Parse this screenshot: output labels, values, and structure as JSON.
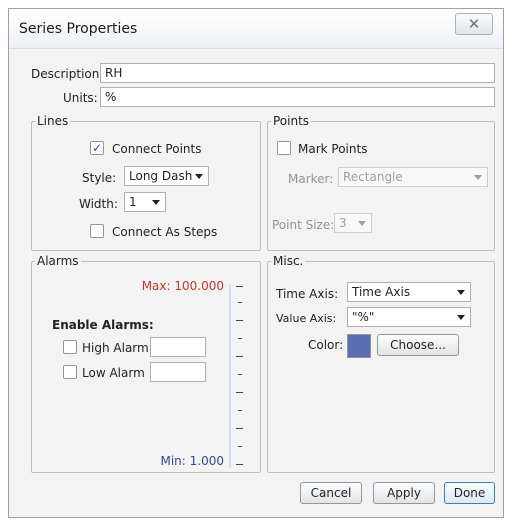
{
  "window": {
    "title": "Series Properties",
    "close_glyph": "✕"
  },
  "fields": {
    "description_label": "Description:",
    "description_value": "RH",
    "units_label": "Units:",
    "units_value": "%"
  },
  "lines": {
    "legend": "Lines",
    "connect_points_label": "Connect Points",
    "connect_points_checked": true,
    "style_label": "Style:",
    "style_value": "Long Dash",
    "width_label": "Width:",
    "width_value": "1",
    "connect_steps_label": "Connect As Steps",
    "connect_steps_checked": false
  },
  "points": {
    "legend": "Points",
    "mark_points_label": "Mark Points",
    "mark_points_checked": false,
    "marker_label": "Marker:",
    "marker_value": "Rectangle",
    "point_size_label": "Point Size:",
    "point_size_value": "3"
  },
  "alarms": {
    "legend": "Alarms",
    "max_label": "Max: 100.000",
    "min_label": "Min: 1.000",
    "enable_label": "Enable Alarms:",
    "high_label": "High Alarm",
    "high_checked": false,
    "high_value": "",
    "low_label": "Low Alarm",
    "low_checked": false,
    "low_value": ""
  },
  "misc": {
    "legend": "Misc.",
    "time_axis_label": "Time Axis:",
    "time_axis_value": "Time Axis",
    "value_axis_label": "Value Axis:",
    "value_axis_value": "\"%\"",
    "color_label": "Color:",
    "color_value": "#5b6eb3",
    "choose_label": "Choose..."
  },
  "buttons": {
    "cancel": "Cancel",
    "apply": "Apply",
    "done": "Done"
  },
  "colors": {
    "max_label": "#c0392b",
    "min_label": "#2c4f8e",
    "scale_line": "#cfe0f0"
  }
}
